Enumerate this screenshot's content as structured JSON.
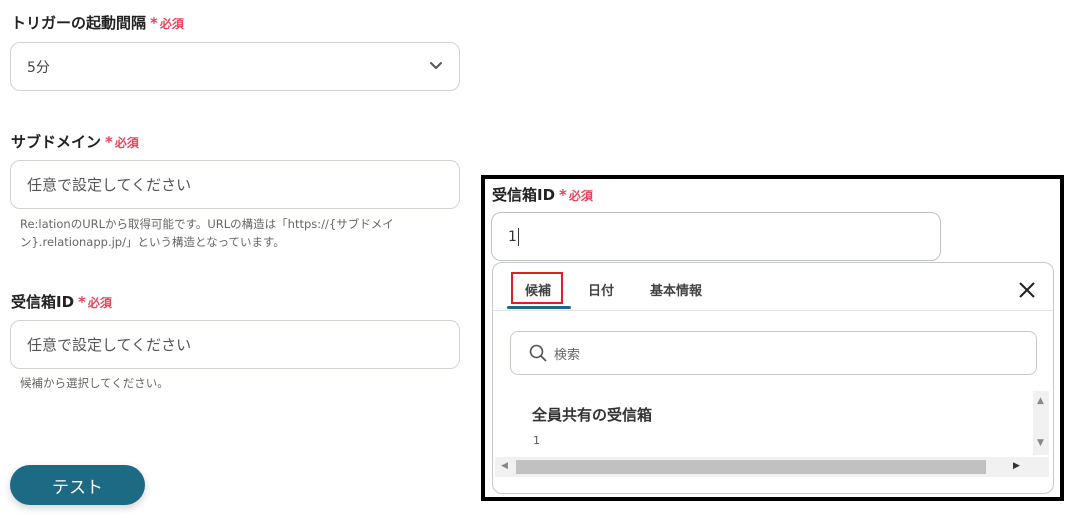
{
  "form": {
    "trigger_interval": {
      "label": "トリガーの起動間隔",
      "required_star": "*",
      "required_text": "必須",
      "value": "5分"
    },
    "subdomain": {
      "label": "サブドメイン",
      "required_star": "*",
      "required_text": "必須",
      "placeholder": "任意で設定してください",
      "help_line1": "Re:lationのURLから取得可能です。URLの構造は「https://{サブドメイ",
      "help_line2": "ン}.relationapp.jp/」という構造となっています。"
    },
    "inbox_id": {
      "label": "受信箱ID",
      "required_star": "*",
      "required_text": "必須",
      "placeholder": "任意で設定してください",
      "help": "候補から選択してください。"
    },
    "test_button": "テスト"
  },
  "popup": {
    "label": "受信箱ID",
    "required_star": "*",
    "required_text": "必須",
    "input_value": "1",
    "tabs": [
      "候補",
      "日付",
      "基本情報"
    ],
    "active_tab": "候補",
    "search_placeholder": "検索",
    "candidate": {
      "title": "全員共有の受信箱",
      "sub": "1"
    }
  },
  "colors": {
    "accent": "#1d6a84",
    "required": "#e8455a",
    "highlight": "#e01e25"
  }
}
